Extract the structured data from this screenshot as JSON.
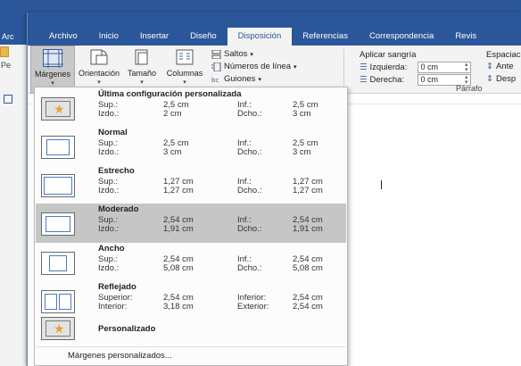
{
  "left_window": {
    "tab_label": "Arc",
    "panel_label": "Pe"
  },
  "tabs": [
    {
      "label": "Archivo",
      "active": false
    },
    {
      "label": "Inicio",
      "active": false
    },
    {
      "label": "Insertar",
      "active": false
    },
    {
      "label": "Diseño",
      "active": false
    },
    {
      "label": "Disposición",
      "active": true
    },
    {
      "label": "Referencias",
      "active": false
    },
    {
      "label": "Correspondencia",
      "active": false
    },
    {
      "label": "Revis",
      "active": false
    }
  ],
  "ribbon": {
    "margins_label": "Márgenes",
    "orientation_label": "Orientación",
    "size_label": "Tamaño",
    "columns_label": "Columnas",
    "breaks_label": "Saltos",
    "line_numbers_label": "Números de línea",
    "hyphenation_label": "Guiones",
    "indent_title": "Aplicar sangría",
    "indent_left_label": "Izquierda:",
    "indent_left_value": "0 cm",
    "indent_right_label": "Derecha:",
    "indent_right_value": "0 cm",
    "paragraph_group_label": "Párrafo",
    "spacing_title": "Espaciac",
    "spacing_before_label": "Ante",
    "spacing_after_label": "Desp"
  },
  "margin_presets": [
    {
      "name": "Última configuración personalizada",
      "l1": "Sup.:",
      "v1": "2,5 cm",
      "l2": "Inf.:",
      "v2": "2,5 cm",
      "l3": "Izdo.:",
      "v3": "2 cm",
      "l4": "Dcho.:",
      "v4": "3 cm",
      "selected": false,
      "icon": "star-page-icon"
    },
    {
      "name": "Normal",
      "l1": "Sup.:",
      "v1": "2,5 cm",
      "l2": "Inf.:",
      "v2": "2,5 cm",
      "l3": "Izdo.:",
      "v3": "3 cm",
      "l4": "Dcho.:",
      "v4": "3 cm",
      "selected": false,
      "icon": "normal-margins-icon"
    },
    {
      "name": "Estrecho",
      "l1": "Sup.:",
      "v1": "1,27 cm",
      "l2": "Inf.:",
      "v2": "1,27 cm",
      "l3": "Izdo.:",
      "v3": "1,27 cm",
      "l4": "Dcho.:",
      "v4": "1,27 cm",
      "selected": false,
      "icon": "narrow-margins-icon"
    },
    {
      "name": "Moderado",
      "l1": "Sup.:",
      "v1": "2,54 cm",
      "l2": "Inf.:",
      "v2": "2,54 cm",
      "l3": "Izdo.:",
      "v3": "1,91 cm",
      "l4": "Dcho.:",
      "v4": "1,91 cm",
      "selected": true,
      "icon": "moderate-margins-icon"
    },
    {
      "name": "Ancho",
      "l1": "Sup.:",
      "v1": "2,54 cm",
      "l2": "Inf.:",
      "v2": "2,54 cm",
      "l3": "Izdo.:",
      "v3": "5,08 cm",
      "l4": "Dcho.:",
      "v4": "5,08 cm",
      "selected": false,
      "icon": "wide-margins-icon"
    },
    {
      "name": "Reflejado",
      "l1": "Superior:",
      "v1": "2,54 cm",
      "l2": "Inferior:",
      "v2": "2,54 cm",
      "l3": "Interior:",
      "v3": "3,18 cm",
      "l4": "Exterior:",
      "v4": "2,54 cm",
      "selected": false,
      "icon": "mirrored-margins-icon"
    }
  ],
  "custom_preset": {
    "name": "Personalizado",
    "icon": "star-page-icon"
  },
  "footer_label": "Márgenes personalizados...",
  "colors": {
    "ribbon_blue": "#2b579a",
    "selected_row": "#c6c6c6",
    "star": "#e6a33b"
  }
}
